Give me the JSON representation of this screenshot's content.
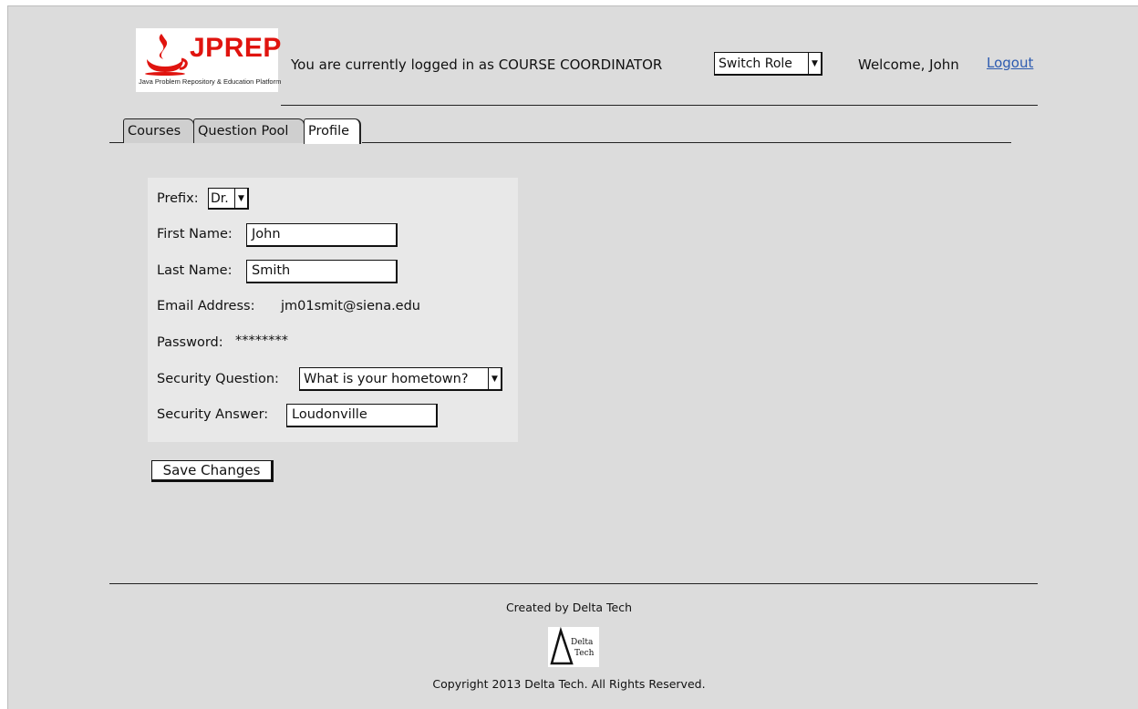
{
  "logo": {
    "brand": "JPREP",
    "tagline": "Java Problem Repository & Education Platform"
  },
  "header": {
    "role_message": "You are currently logged in as COURSE COORDINATOR",
    "switch_role": "Switch Role",
    "welcome": "Welcome, John",
    "logout": "Logout"
  },
  "tabs": [
    "Courses",
    "Question Pool",
    "Profile"
  ],
  "active_tab": "Profile",
  "profile": {
    "prefix_label": "Prefix:",
    "prefix_value": "Dr.",
    "first_name_label": "First Name:",
    "first_name_value": "John",
    "last_name_label": "Last Name:",
    "last_name_value": "Smith",
    "email_label": "Email Address:",
    "email_value": "jm01smit@siena.edu",
    "password_label": "Password:",
    "password_value": "********",
    "security_question_label": "Security Question:",
    "security_question_value": "What is your hometown?",
    "security_answer_label": "Security Answer:",
    "security_answer_value": "Loudonville"
  },
  "save_button": "Save Changes",
  "footer": {
    "created_by": "Created by Delta Tech",
    "logo_text_line1": "Delta",
    "logo_text_line2": "Tech",
    "copyright": "Copyright 2013 Delta Tech. All Rights Reserved."
  },
  "colors": {
    "brand_red": "#e0140f",
    "link_blue": "#2d5bb0",
    "background": "#dcdcdc"
  }
}
